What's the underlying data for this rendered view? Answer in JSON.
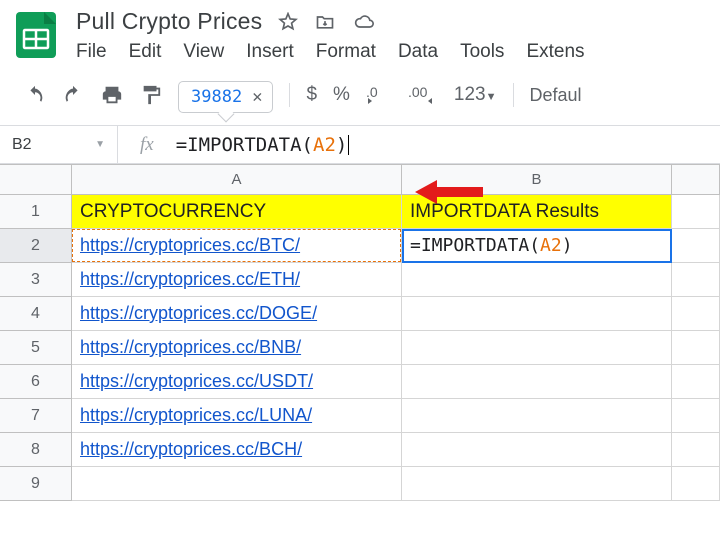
{
  "doc": {
    "title": "Pull Crypto Prices"
  },
  "menubar": [
    "File",
    "Edit",
    "View",
    "Insert",
    "Format",
    "Data",
    "Tools",
    "Extens"
  ],
  "toolbar": {
    "chip_value": "39882",
    "dollar": "$",
    "percent": "%",
    "dec_dec": ".0",
    "inc_dec": ".00",
    "num123": "123",
    "font_name": "Defaul"
  },
  "namebox": "B2",
  "formula": {
    "prefix": "=IMPORTDATA(",
    "ref": "A2",
    "suffix": ")"
  },
  "cols": [
    "A",
    "B"
  ],
  "headers": {
    "A": "CRYPTOCURRENCY",
    "B": "IMPORTDATA Results"
  },
  "active_cell_display": {
    "prefix": "=IMPORTDATA(",
    "ref": "A2",
    "suffix": ")"
  },
  "rows": [
    {
      "n": 1
    },
    {
      "n": 2,
      "A": "https://cryptoprices.cc/BTC/"
    },
    {
      "n": 3,
      "A": "https://cryptoprices.cc/ETH/"
    },
    {
      "n": 4,
      "A": "https://cryptoprices.cc/DOGE/"
    },
    {
      "n": 5,
      "A": "https://cryptoprices.cc/BNB/"
    },
    {
      "n": 6,
      "A": "https://cryptoprices.cc/USDT/"
    },
    {
      "n": 7,
      "A": "https://cryptoprices.cc/LUNA/"
    },
    {
      "n": 8,
      "A": "https://cryptoprices.cc/BCH/"
    },
    {
      "n": 9
    }
  ]
}
